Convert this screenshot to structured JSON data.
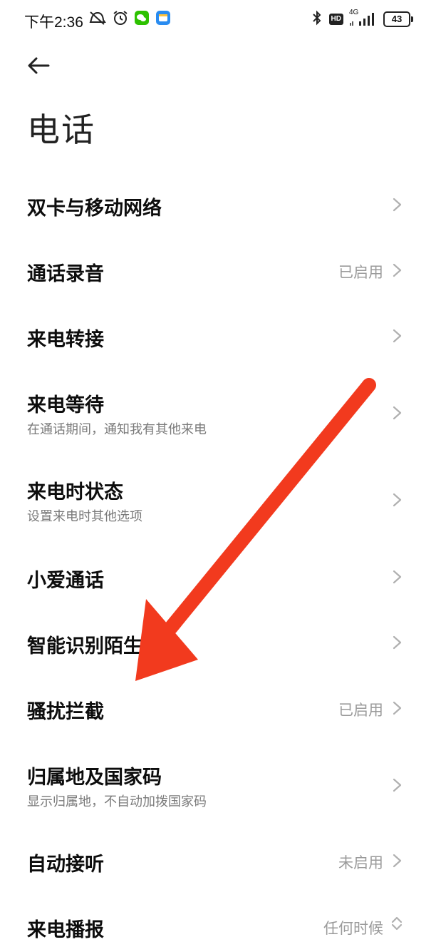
{
  "status_bar": {
    "time": "下午2:36",
    "network": "4G",
    "hd": "HD",
    "battery": "43",
    "left_icons": [
      "mute-icon",
      "alarm-icon",
      "wechat-icon",
      "notification-app-icon"
    ],
    "right_icons": [
      "bluetooth-icon",
      "hd-icon",
      "signal-icon",
      "battery-icon"
    ]
  },
  "header": {
    "back_icon": "back-arrow-icon",
    "title": "电话"
  },
  "settings": [
    {
      "id": "dual-sim",
      "title": "双卡与移动网络",
      "subtitle": "",
      "value": ""
    },
    {
      "id": "call-recording",
      "title": "通话录音",
      "subtitle": "",
      "value": "已启用"
    },
    {
      "id": "call-forwarding",
      "title": "来电转接",
      "subtitle": "",
      "value": ""
    },
    {
      "id": "call-waiting",
      "title": "来电等待",
      "subtitle": "在通话期间，通知我有其他来电",
      "value": ""
    },
    {
      "id": "incoming-call-status",
      "title": "来电时状态",
      "subtitle": "设置来电时其他选项",
      "value": ""
    },
    {
      "id": "xiaoai-call",
      "title": "小爱通话",
      "subtitle": "",
      "value": ""
    },
    {
      "id": "smart-identify",
      "title": "智能识别陌生号码",
      "subtitle": "",
      "value": ""
    },
    {
      "id": "spam-block",
      "title": "骚扰拦截",
      "subtitle": "",
      "value": "已启用"
    },
    {
      "id": "location-code",
      "title": "归属地及国家码",
      "subtitle": "显示归属地，不自动加拨国家码",
      "value": ""
    },
    {
      "id": "auto-answer",
      "title": "自动接听",
      "subtitle": "",
      "value": "未启用"
    },
    {
      "id": "caller-announce",
      "title": "来电播报",
      "subtitle": "",
      "value": "任何时候"
    }
  ],
  "annotation": {
    "arrow_color": "#f23a1e"
  }
}
